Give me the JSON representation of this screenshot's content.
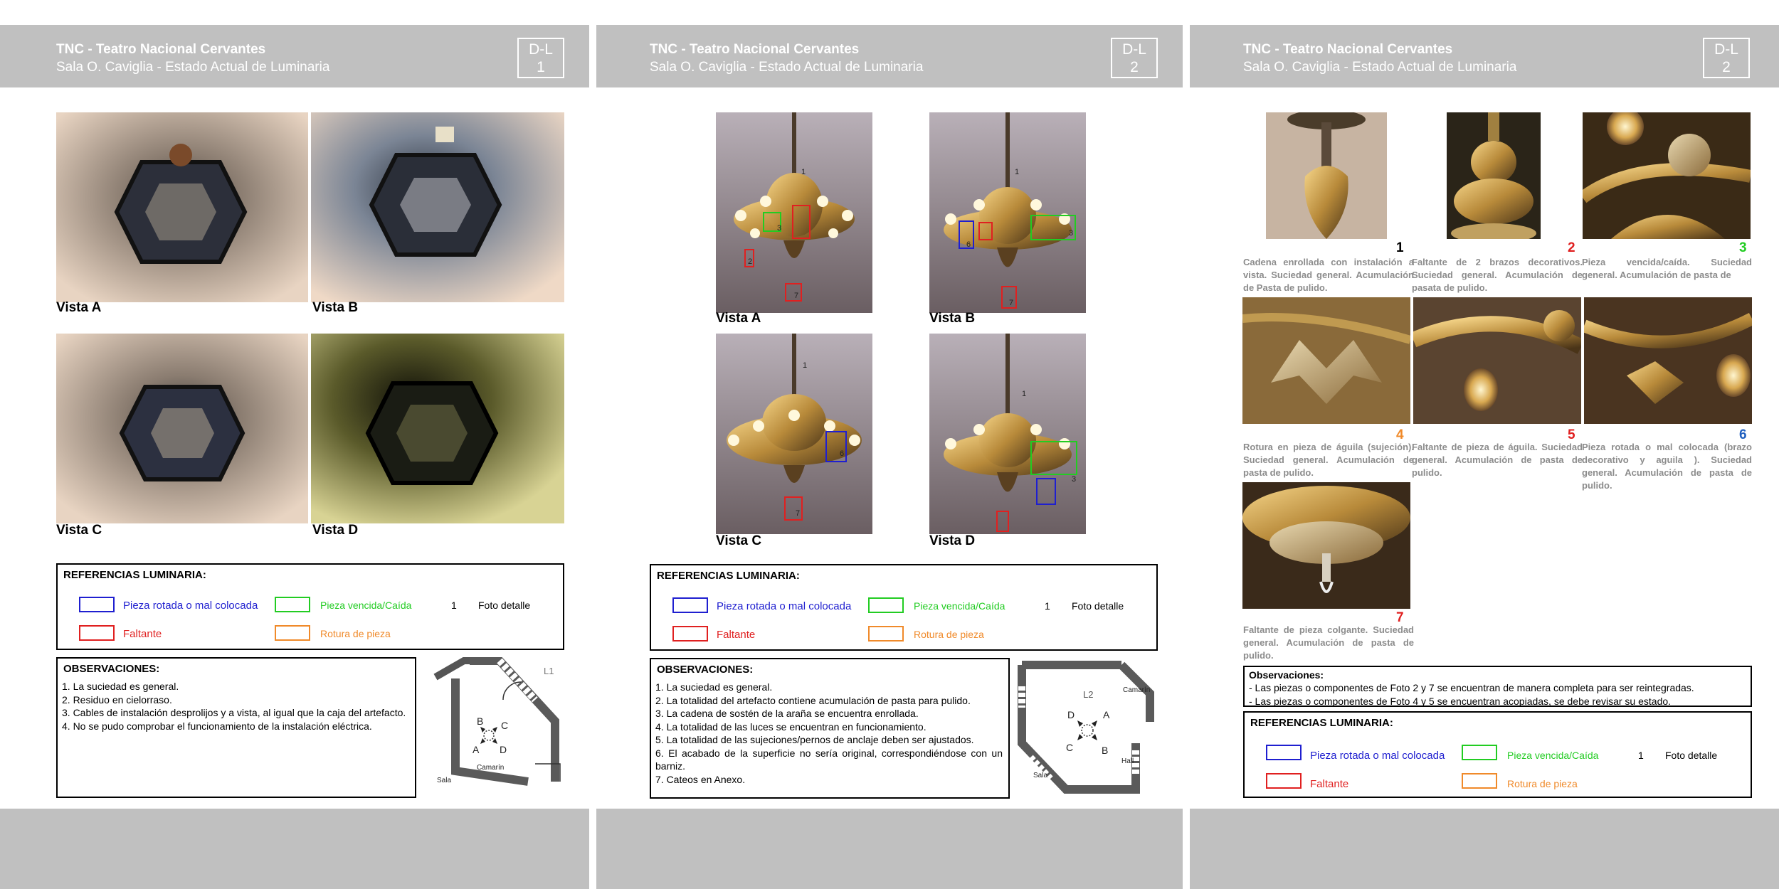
{
  "header": {
    "title": "TNC - Teatro Nacional Cervantes",
    "subtitle": "Sala O. Caviglia - Estado Actual de Luminaria"
  },
  "sheets": [
    {
      "dl_prefix": "D-L",
      "dl_num": "1"
    },
    {
      "dl_prefix": "D-L",
      "dl_num": "2"
    },
    {
      "dl_prefix": "D-L",
      "dl_num": "2"
    }
  ],
  "views": {
    "a": "Vista A",
    "b": "Vista B",
    "c": "Vista C",
    "d": "Vista D"
  },
  "legend": {
    "title": "REFERENCIAS LUMINARIA:",
    "rotated": "Pieza rotada o mal colocada",
    "fallen": "Pieza vencida/Caída",
    "missing": "Faltante",
    "broken": "Rotura de pieza",
    "detail_num": "1",
    "detail": "Foto detalle"
  },
  "colors": {
    "blue": "#1f1fd0",
    "green": "#22cc22",
    "red": "#e02020",
    "orange": "#f08a2a",
    "grey": "#8c8c8c"
  },
  "obs1": {
    "title": "OBSERVACIONES:",
    "lines": [
      "1. La suciedad es general.",
      "2. Residuo en cielorraso.",
      "3. Cables de instalación desprolijos y a vista, al igual que la caja del artefacto.",
      "4. No se pudo comprobar el funcionamiento de la instalación eléctrica."
    ]
  },
  "obs2": {
    "title": "OBSERVACIONES:",
    "lines": [
      "1. La suciedad es general.",
      "2. La totalidad del artefacto contiene acumulación de pasta para pulido.",
      "3. La cadena de sostén de la araña se encuentra enrollada.",
      "4. La totalidad de las luces se encuentran en funcionamiento.",
      "5. La totalidad de las sujeciones/pernos de anclaje deben ser ajustados.",
      "6. El acabado de la superficie no sería original, correspondiéndose con un barniz.",
      "7. Cateos en Anexo."
    ]
  },
  "plan1": {
    "id": "L1",
    "labels": {
      "a": "A",
      "b": "B",
      "c": "C",
      "d": "D"
    },
    "room": "Camarín",
    "sala": "Sala"
  },
  "plan2": {
    "id": "L2",
    "labels": {
      "a": "A",
      "b": "B",
      "c": "C",
      "d": "D"
    },
    "room": "Camarín",
    "hall": "Hall",
    "sala": "Sala"
  },
  "marks": {
    "n1": "1",
    "n2": "2",
    "n3": "3",
    "n4": "4",
    "n5": "5",
    "n6": "6",
    "n7": "7"
  },
  "details": [
    {
      "num": "1",
      "text": "Cadena enrollada con instalación a vista. Suciedad general. Acumulación de Pasta de pulido."
    },
    {
      "num": "2",
      "text": "Faltante de 2 brazos decorativos. Suciedad general. Acumulación de pasata de pulido."
    },
    {
      "num": "3",
      "text": "Pieza vencida/caída. Suciedad general. Acumulación de pasta de"
    },
    {
      "num": "4",
      "text": "Rotura en pieza de águila (sujeción). Suciedad general. Acumulación de pasta de pulido."
    },
    {
      "num": "5",
      "text": "Faltante de pieza de águila. Suciedad general. Acumulación de pasta de pulido."
    },
    {
      "num": "6",
      "text": "Pieza rotada o mal colocada (brazo decorativo y aguila ). Suciedad general. Acumulación de pasta de pulido."
    },
    {
      "num": "7",
      "text": "Faltante de pieza colgante. Suciedad general. Acumulación de pasta de pulido."
    }
  ],
  "obs3": {
    "title": "Observaciones:",
    "lines": [
      "- Las piezas o componentes de Foto 2 y 7 se encuentran de manera completa para ser reintegradas.",
      "- Las piezas o componentes de Foto 4 y 5 se encuentran acopiadas, se debe revisar su estado."
    ]
  }
}
